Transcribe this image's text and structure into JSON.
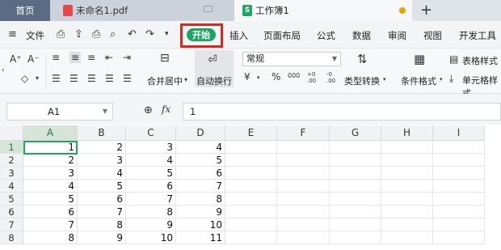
{
  "tabs": {
    "home": "首页",
    "pdf": "未命名1.pdf",
    "workbook": "工作簿1"
  },
  "menu": {
    "file": "文件",
    "start": "开始",
    "insert": "插入",
    "page_layout": "页面布局",
    "formula": "公式",
    "data": "数据",
    "review": "审阅",
    "view": "视图",
    "dev_tools": "开发工具"
  },
  "ribbon": {
    "merge_center": "合并居中",
    "auto_wrap": "自动换行",
    "number_format": "常规",
    "type_convert": "类型转换",
    "cond_format": "条件格式",
    "table_style": "表格样式",
    "cell_style": "单元格样式",
    "currency": "¥",
    "percent": "%",
    "thousands": "000",
    "inc_decimal": "+0 .00",
    "dec_decimal": "-0 .00"
  },
  "formula_bar": {
    "name_box": "A1",
    "fx": "fx",
    "value": "1"
  },
  "grid": {
    "columns": [
      "A",
      "B",
      "C",
      "D",
      "E",
      "F",
      "G",
      "H",
      "I"
    ],
    "rows": [
      "1",
      "2",
      "3",
      "4",
      "5",
      "6",
      "7",
      "8"
    ],
    "data": [
      [
        "1",
        "2",
        "3",
        "4"
      ],
      [
        "2",
        "3",
        "4",
        "5"
      ],
      [
        "3",
        "4",
        "5",
        "6"
      ],
      [
        "4",
        "5",
        "6",
        "7"
      ],
      [
        "5",
        "6",
        "7",
        "8"
      ],
      [
        "6",
        "7",
        "8",
        "9"
      ],
      [
        "7",
        "8",
        "9",
        "10"
      ],
      [
        "8",
        "9",
        "10",
        "11"
      ]
    ]
  },
  "colors": {
    "accent": "#1fa463",
    "highlight": "#e0241b"
  }
}
